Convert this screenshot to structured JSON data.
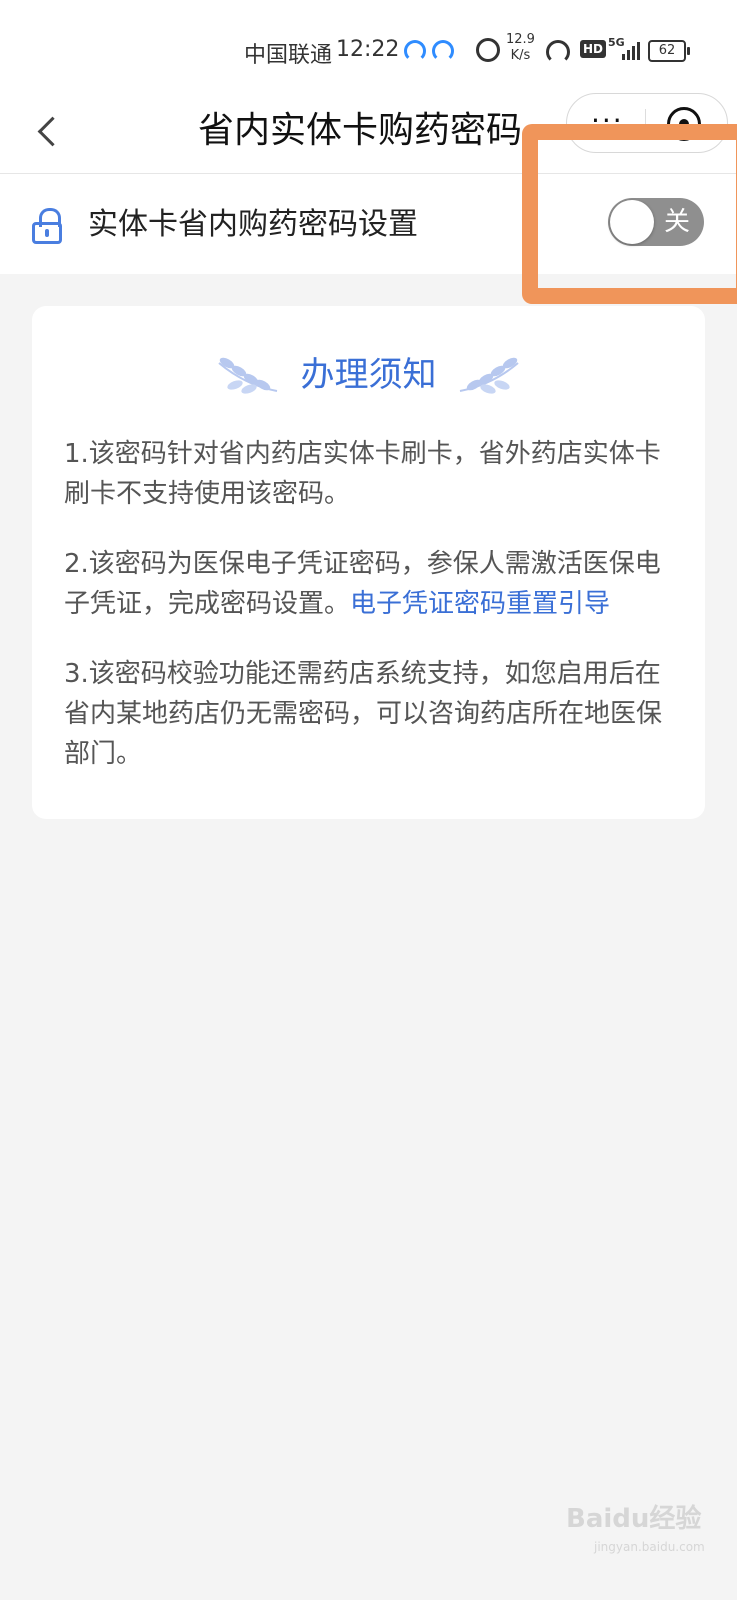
{
  "status_bar": {
    "carrier": "中国联通",
    "time": "12:22",
    "net_speed_value": "12.9",
    "net_speed_unit": "K/s",
    "hd": "HD",
    "network": "5G",
    "battery": "62"
  },
  "header": {
    "title": "省内实体卡购药密码",
    "more": "···"
  },
  "setting": {
    "label": "实体卡省内购药密码设置",
    "switch_state_text": "关",
    "enabled": false
  },
  "notice": {
    "title": "办理须知",
    "item1": "1.该密码针对省内药店实体卡刷卡，省外药店实体卡刷卡不支持使用该密码。",
    "item2_text": "2.该密码为医保电子凭证密码，参保人需激活医保电子凭证，完成密码设置。",
    "item2_link": "电子凭证密码重置引导",
    "item3": "3.该密码校验功能还需药店系统支持，如您启用后在省内某地药店仍无需密码，可以咨询药店所在地医保部门。"
  },
  "watermark": {
    "text": "Baidu经验",
    "sub": "jingyan.baidu.com"
  },
  "colors": {
    "accent": "#3a6fd6",
    "highlight": "#f0955a",
    "switch_off": "#8f8f8f"
  }
}
